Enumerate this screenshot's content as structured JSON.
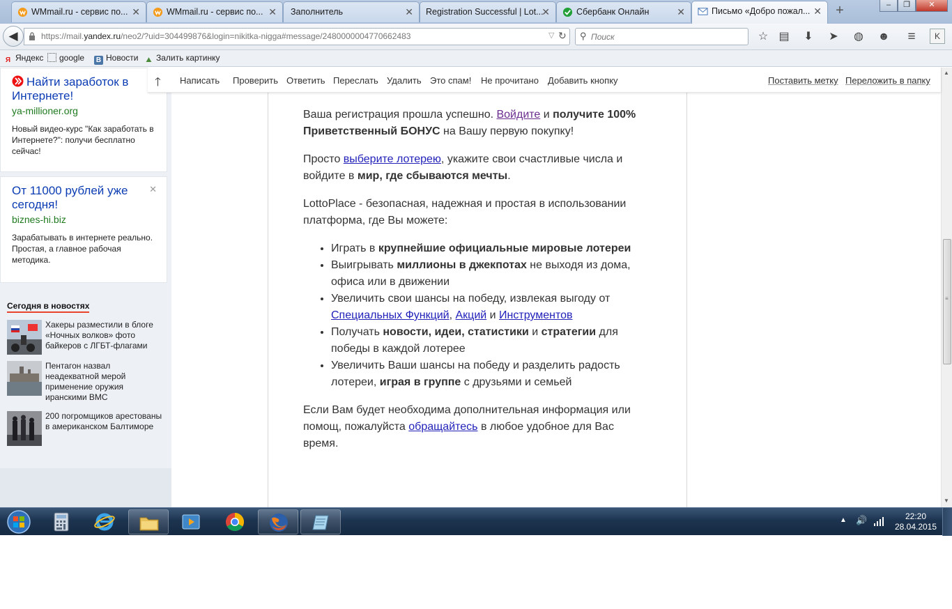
{
  "browser": {
    "tabs": [
      {
        "label": "WMmail.ru - сервис по...",
        "icon": "wmmail-icon"
      },
      {
        "label": "WMmail.ru - сервис по...",
        "icon": "wmmail-icon"
      },
      {
        "label": "Заполнитель",
        "icon": ""
      },
      {
        "label": "Registration Successful | Lot...",
        "icon": ""
      },
      {
        "label": "Сбербанк Онлайн",
        "icon": "sberbank-icon"
      },
      {
        "label": "Письмо «Добро пожал...",
        "icon": "mail-icon"
      }
    ],
    "window_controls": {
      "minimize": "–",
      "maximize": "❐",
      "close": "✕"
    },
    "url_prefix": "https://mail.",
    "url_host": "yandex.ru",
    "url_rest": "/neo2/?uid=304499876&login=nikitka-nigga#message/2480000004770662483",
    "search_placeholder": "Поиск",
    "profile_label": "K"
  },
  "bookmarks": [
    {
      "label": "Яндекс",
      "icon": "yandex-icon"
    },
    {
      "label": "google",
      "icon": "dotted-square-icon"
    },
    {
      "label": "Новости",
      "icon": "vk-icon"
    },
    {
      "label": "Залить картинку",
      "icon": "image-upload-icon"
    }
  ],
  "ads": [
    {
      "title": "Найти заработок в Интернете!",
      "domain": "ya-millioner.org",
      "text": "Новый видео-курс \"Как заработать в Интернете?\": получи бесплатно сейчас!"
    },
    {
      "title": "От 11000 рублей уже сегодня!",
      "domain": "biznes-hi.biz",
      "text": "Зарабатывать в интернете реально. Простая, а главное рабочая методика."
    }
  ],
  "news": {
    "heading": "Сегодня в новостях",
    "items": [
      {
        "text": "Хакеры разместили в блоге «Ночных волков» фото байкеров с ЛГБТ-флагами"
      },
      {
        "text": "Пентагон назвал неадекватной мерой применение оружия иранскими ВМС"
      },
      {
        "text": "200 погромщиков арестованы в американском Балтиморе"
      }
    ]
  },
  "mail_toolbar": {
    "buttons": [
      "Написать",
      "Проверить",
      "Ответить",
      "Переслать",
      "Удалить",
      "Это спам!",
      "Не прочитано",
      "Добавить кнопку"
    ],
    "links": [
      "Поставить метку",
      "Переложить в папку"
    ]
  },
  "message": {
    "p1": {
      "a": "Ваша регистрация прошла успешно. ",
      "link": "Войдите",
      "b": " и ",
      "bold1": "получите 100% Приветственный БОНУС",
      "c": " на Вашу первую покупку!"
    },
    "p2": {
      "a": "Просто ",
      "link": "выберите лотерею",
      "b": ", укажите свои счастливые числа и войдите в ",
      "bold": "мир, где сбываются мечты",
      "c": "."
    },
    "p3": "LottoPlace - безопасная, надежная и простая в использовании платформа, где Вы можете:",
    "list": {
      "i1": {
        "a": "Играть в ",
        "bold": "крупнейшие официальные мировые лотереи"
      },
      "i2": {
        "a": "Выигрывать ",
        "bold": "миллионы в джекпотах",
        "b": " не выходя из дома, офиса или в движении"
      },
      "i3": {
        "a": "Увеличить свои шансы на победу, извлекая выгоду от ",
        "link1": "Специальных Функций",
        "sep1": ", ",
        "link2": "Акций",
        "sep2": " и ",
        "link3": "Инструментов"
      },
      "i4": {
        "a": "Получать ",
        "bold1": "новости, идеи, статистики",
        "b": " и ",
        "bold2": "стратегии",
        "c": " для победы в каждой лотерее"
      },
      "i5": {
        "a": "Увеличить Ваши шансы на победу и разделить радость лотереи, ",
        "bold": "играя в группе",
        "b": " с друзьями и семьей"
      }
    },
    "p4": {
      "a": "Если Вам будет необходима дополнительная информация или помощ, пожалуйста ",
      "link": "обращайтесь",
      "b": " в любое удобное для Вас время."
    }
  },
  "taskbar": {
    "items": [
      {
        "name": "calculator-icon",
        "open": false
      },
      {
        "name": "internet-explorer-icon",
        "open": false
      },
      {
        "name": "file-explorer-icon",
        "open": true
      },
      {
        "name": "media-player-icon",
        "open": false
      },
      {
        "name": "chrome-icon",
        "open": false
      },
      {
        "name": "firefox-icon",
        "open": true
      },
      {
        "name": "notepad-icon",
        "open": true
      }
    ],
    "time": "22:20",
    "date": "28.04.2015"
  },
  "colors": {
    "ad_title": "#0b3cb3",
    "ad_domain": "#1f7a1f",
    "link": "#2222bb",
    "visited_link": "#6b2c8f",
    "news_underline": "#e8442b"
  }
}
